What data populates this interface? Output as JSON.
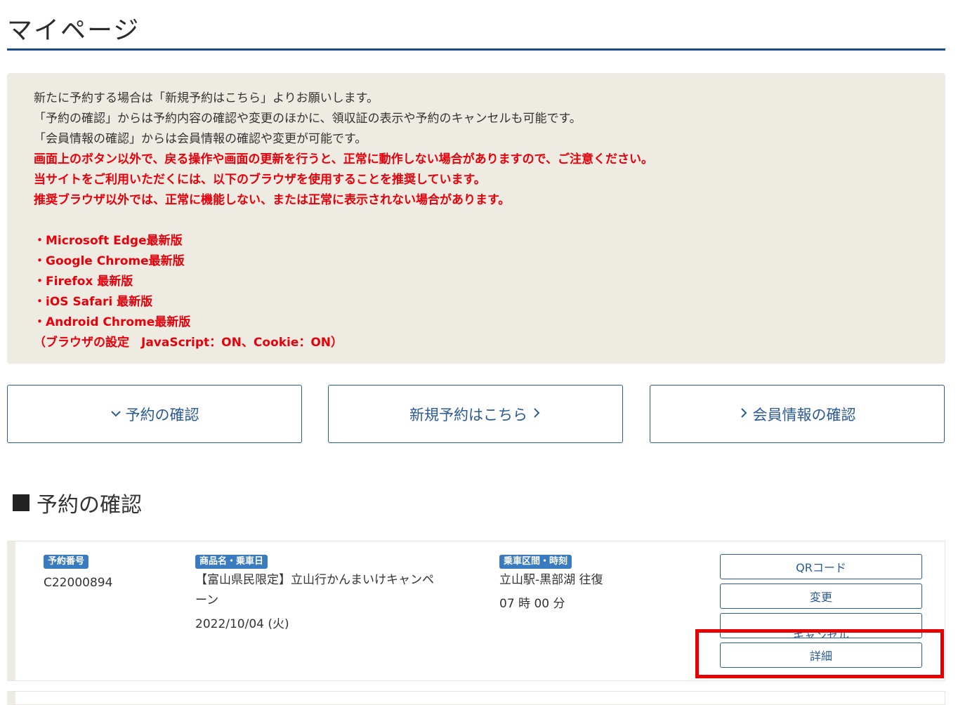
{
  "page": {
    "title": "マイページ"
  },
  "notice": {
    "normal_lines": [
      "新たに予約する場合は「新規予約はこちら」よりお願いします。",
      "「予約の確認」からは予約内容の確認や変更のほかに、領収証の表示や予約のキャンセルも可能です。",
      "「会員情報の確認」からは会員情報の確認や変更が可能です。"
    ],
    "warning_lines": [
      "画面上のボタン以外で、戻る操作や画面の更新を行うと、正常に動作しない場合がありますので、ご注意ください。",
      "当サイトをご利用いただくには、以下のブラウザを使用することを推奨しています。",
      "推奨ブラウザ以外では、正常に機能しない、または正常に表示されない場合があります。"
    ],
    "browsers": [
      "・Microsoft Edge最新版",
      "・Google Chrome最新版",
      "・Firefox 最新版",
      "・iOS Safari 最新版",
      "・Android Chrome最新版",
      "（ブラウザの設定　JavaScript：ON、Cookie：ON）"
    ]
  },
  "nav": {
    "confirm_label": "予約の確認",
    "new_label": "新規予約はこちら",
    "member_label": "会員情報の確認"
  },
  "section": {
    "title": "予約の確認"
  },
  "reservation": {
    "number_tag": "予約番号",
    "number": "C22000894",
    "product_tag": "商品名・乗車日",
    "product_line1": "【富山県民限定】立山行かんまいけキャンペ",
    "product_line2": "ーン",
    "date": "2022/10/04 (火)",
    "route_tag": "乗車区間・時刻",
    "route": "立山駅-黒部湖 往復",
    "time": "07 時 00 分",
    "buttons": {
      "qr": "QRコード",
      "change": "変更",
      "cancel": "キャンセル",
      "detail": "詳細"
    }
  },
  "colors": {
    "accent": "#2b5a98",
    "warning": "#e8000b",
    "notice_bg": "#eeebe2",
    "tag_bg": "#3a7abf",
    "highlight": "#e60000"
  }
}
